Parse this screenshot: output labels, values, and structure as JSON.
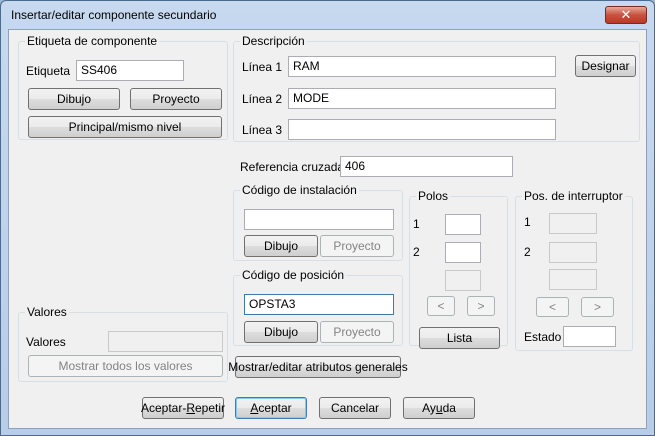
{
  "window": {
    "title": "Insertar/editar componente secundario",
    "close_glyph": "✕"
  },
  "etiqueta": {
    "group_title": "Etiqueta de componente",
    "label": "Etiqueta",
    "value": "SS406",
    "dibujo": "Dibujo",
    "proyecto": "Proyecto",
    "principal": "Principal/mismo nivel"
  },
  "descripcion": {
    "group_title": "Descripción",
    "linea1_label": "Línea 1",
    "linea1_value": "RAM",
    "linea2_label": "Línea 2",
    "linea2_value": "MODE",
    "linea3_label": "Línea 3",
    "linea3_value": "",
    "designar": "Designar"
  },
  "referencia": {
    "label": "Referencia cruzada",
    "value": "406"
  },
  "instalacion": {
    "group_title": "Código de instalación",
    "value": "",
    "dibujo": "Dibujo",
    "proyecto": "Proyecto"
  },
  "posicion": {
    "group_title": "Código de posición",
    "value": "OPSTA3",
    "dibujo": "Dibujo",
    "proyecto": "Proyecto"
  },
  "polos": {
    "group_title": "Polos",
    "label1": "1",
    "label2": "2",
    "prev": "<",
    "next": ">",
    "lista": "Lista"
  },
  "interruptor": {
    "group_title": "Pos. de interruptor",
    "label1": "1",
    "label2": "2",
    "prev": "<",
    "next": ">",
    "estado_label": "Estado"
  },
  "valores": {
    "group_title": "Valores",
    "label": "Valores",
    "mostrar": "Mostrar todos los valores"
  },
  "mostrar_atributos": "Mostrar/editar atributos generales",
  "footer": {
    "aceptar_repetir_pre": "Aceptar-",
    "aceptar_repetir_u": "R",
    "aceptar_repetir_post": "epetir",
    "aceptar_u": "A",
    "aceptar_post": "ceptar",
    "cancelar": "Cancelar",
    "ayuda_pre": "Ay",
    "ayuda_u": "u",
    "ayuda_post": "da"
  }
}
